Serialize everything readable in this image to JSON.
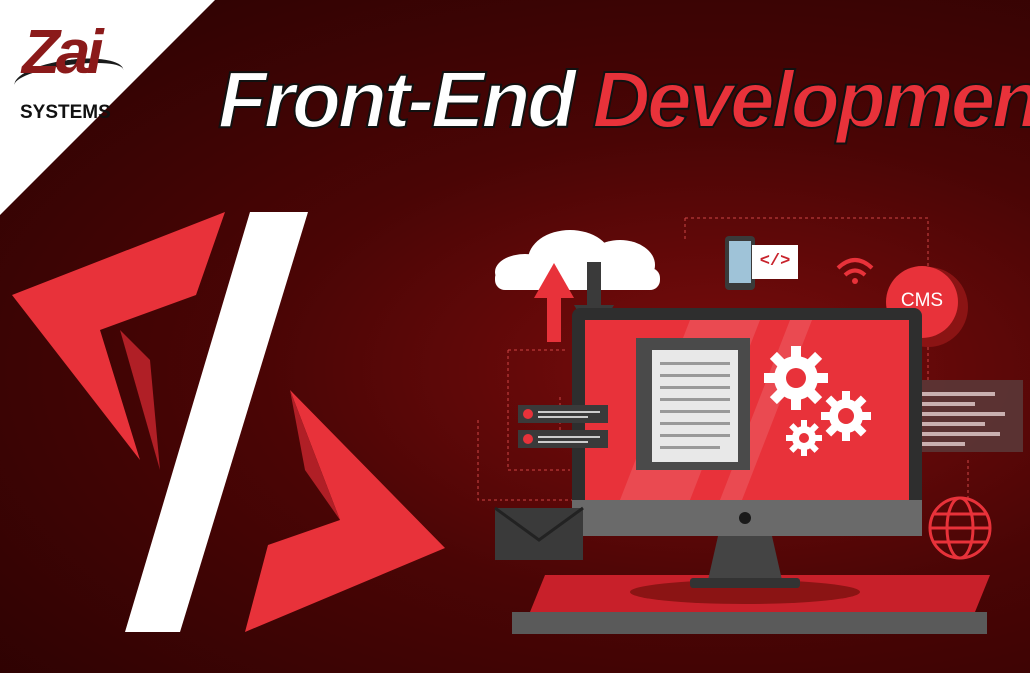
{
  "brand": {
    "mark": "Zai",
    "name": "SYSTEMS"
  },
  "title": {
    "part1": "Front-End",
    "part2": "Development"
  },
  "badges": {
    "cms": "CMS",
    "code_tag": "</>"
  },
  "colors": {
    "accent": "#e8323a",
    "background": "#4a0505",
    "dark": "#3a3a3a"
  },
  "icons": [
    "code-slash-icon",
    "cloud-icon",
    "upload-arrow-icon",
    "download-arrow-icon",
    "phone-icon",
    "wifi-icon",
    "cms-badge-icon",
    "monitor-icon",
    "document-icon",
    "gears-icon",
    "user-card-icon",
    "envelope-icon",
    "globe-icon",
    "code-lines-icon"
  ]
}
